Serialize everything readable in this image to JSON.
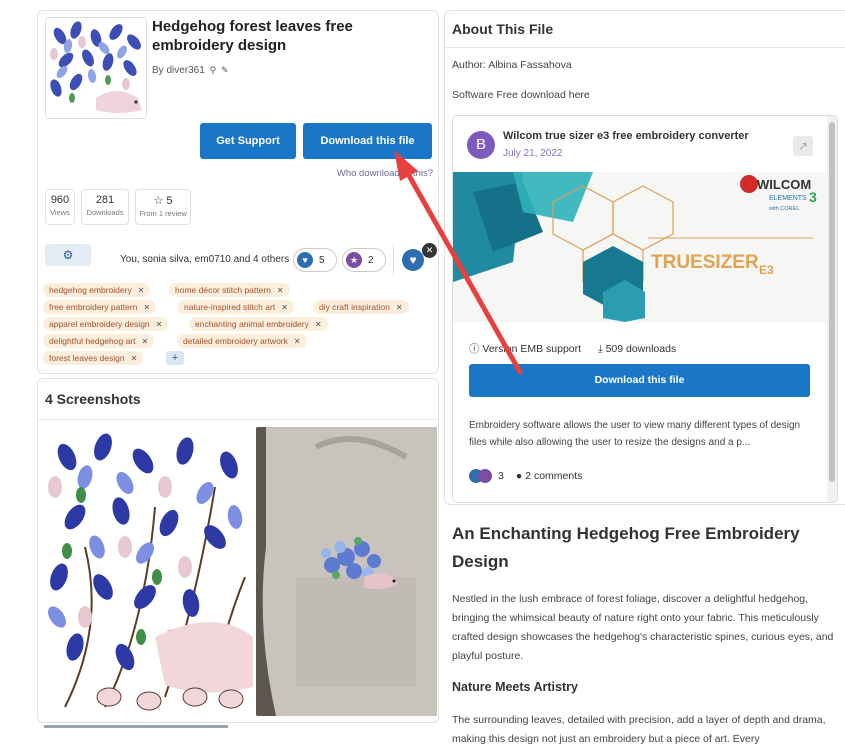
{
  "file": {
    "title": "Hedgehog forest leaves free embroidery design",
    "by_label": "By diver361",
    "support_label": "Get Support",
    "download_label": "Download this file",
    "who_downloaded": "Who downloaded this?"
  },
  "stats": [
    {
      "num": "960",
      "label": "Views"
    },
    {
      "num": "281",
      "label": "Downloads"
    },
    {
      "num": "☆ 5",
      "label": "From 1 review"
    }
  ],
  "reactions": {
    "liked_by": "You, sonia silva, em0710 and 4 others",
    "likes": "5",
    "awards": "2"
  },
  "tags": [
    "hedgehog embroidery",
    "home décor stitch pattern",
    "free embroidery pattern",
    "nature-inspired stitch art",
    "diy craft inspiration",
    "apparel embroidery design",
    "enchanting animal embroidery",
    "delightful hedgehog art",
    "detailed embroidery artwork",
    "forest leaves design"
  ],
  "tag_add": "+",
  "screenshots": {
    "title": "4 Screenshots"
  },
  "about": {
    "title": "About This File",
    "author": "Author: Albina Fassahova",
    "software": "Software Free download here"
  },
  "embed": {
    "avatar_letter": "B",
    "title": "Wilcom true sizer e3 free embroidery converter",
    "date": "July 21, 2022",
    "banner_brand": "WILCOM",
    "banner_brand_sub": "ELEMENTS",
    "banner_version": "3",
    "banner_corel": "with COREL",
    "banner_product": "TRUESIZER",
    "banner_product_suffix": "E3",
    "version": "Version EMB support",
    "downloads": "509 downloads",
    "download_label": "Download this file",
    "description": "Embroidery software allows the user to view many different types of design files while also allowing the user to resize the designs and a p...",
    "reactions": "3",
    "comments": "2 comments"
  },
  "article": {
    "heading": "An Enchanting Hedgehog Free Embroidery Design",
    "p1": "Nestled in the lush embrace of forest foliage, discover a delightful hedgehog, bringing the whimsical beauty of nature right onto your fabric. This meticulously crafted design showcases the hedgehog's characteristic spines, curious eyes, and playful posture.",
    "subheading": "Nature Meets Artistry",
    "p2": "The surrounding leaves, detailed with precision, add a layer of depth and drama, making this design not just an embroidery but a piece of art. Every"
  },
  "colors": {
    "primary_button": "#1a76c7",
    "tag_bg": "#fbeedd",
    "tag_text": "#a0522d",
    "annotation_arrow": "#e8403f"
  }
}
